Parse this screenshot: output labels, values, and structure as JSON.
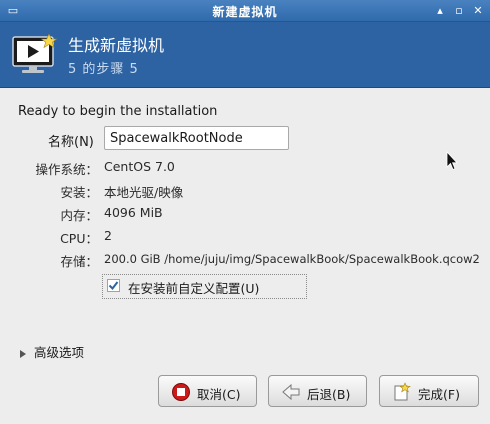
{
  "window": {
    "title": "新建虚拟机",
    "menu_glyph": "▭",
    "controls": [
      "▴",
      "▫",
      "✕"
    ]
  },
  "header": {
    "title": "生成新虚拟机",
    "step": "5 的步骤 5"
  },
  "summary": {
    "lead": "Ready to begin the installation",
    "name_label": "名称(N)",
    "name_value": "SpacewalkRootNode",
    "rows": [
      {
        "label": "操作系统：",
        "value": "CentOS 7.0"
      },
      {
        "label": "安装：",
        "value": "本地光驱/映像"
      },
      {
        "label": "内存：",
        "value": "4096 MiB"
      },
      {
        "label": "CPU：",
        "value": "2"
      },
      {
        "label": "存储：",
        "value": "200.0 GiB /home/juju/img/SpacewalkBook/SpacewalkBook.qcow2"
      }
    ],
    "customize_label": "在安装前自定义配置(U)",
    "customize_checked": true
  },
  "advanced": {
    "label": "高级选项"
  },
  "buttons": {
    "cancel": "取消(C)",
    "back": "后退(B)",
    "finish": "完成(F)"
  },
  "colors": {
    "titlebar": "#3a74b6",
    "banner": "#2d63a3",
    "cancel_icon": "#cc1a1a"
  }
}
